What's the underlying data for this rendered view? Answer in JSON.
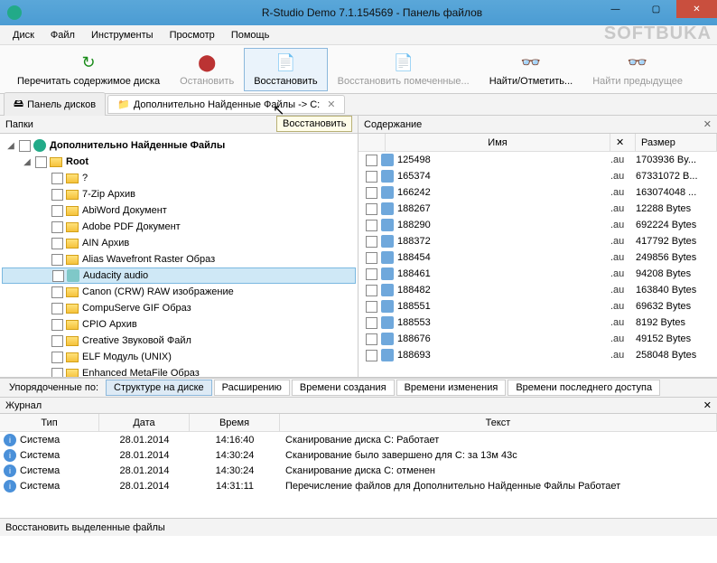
{
  "window": {
    "title": "R-Studio Demo 7.1.154569 - Панель файлов",
    "watermark": "SOFTBUKA"
  },
  "menu": [
    "Диск",
    "Файл",
    "Инструменты",
    "Просмотр",
    "Помощь"
  ],
  "toolbar": [
    {
      "id": "refresh",
      "label": "Перечитать содержимое диска",
      "icon": "↻",
      "color": "#1a8c1a"
    },
    {
      "id": "stop",
      "label": "Остановить",
      "icon": "⬤",
      "color": "#b33",
      "disabled": true
    },
    {
      "id": "restore",
      "label": "Восстановить",
      "icon": "📄",
      "color": "#d88",
      "active": true
    },
    {
      "id": "restore-marked",
      "label": "Восстановить помеченные...",
      "icon": "📄",
      "color": "#bbb",
      "disabled": true
    },
    {
      "id": "find",
      "label": "Найти/Отметить...",
      "icon": "👓",
      "color": "#4a90d9"
    },
    {
      "id": "find-prev",
      "label": "Найти предыдущее",
      "icon": "👓",
      "color": "#bbb",
      "disabled": true
    }
  ],
  "tooltip": "Восстановить",
  "tabs": [
    {
      "id": "disks",
      "icon": "🖴",
      "label": "Панель дисков"
    },
    {
      "id": "extra",
      "icon": "📁",
      "label": "Дополнительно Найденные Файлы  ->  C:",
      "active": true
    }
  ],
  "leftPane": {
    "title": "Папки",
    "root": {
      "expander": "◢",
      "label": "Дополнительно Найденные Файлы",
      "bold": true,
      "indent": 0,
      "iconType": "green"
    },
    "rootsub": {
      "expander": "◢",
      "label": "Root",
      "bold": true,
      "indent": 1,
      "iconType": "folder"
    },
    "items": [
      {
        "label": "?"
      },
      {
        "label": "7-Zip Архив"
      },
      {
        "label": "AbiWord Документ"
      },
      {
        "label": "Adobe PDF Документ"
      },
      {
        "label": "AIN Архив"
      },
      {
        "label": "Alias Wavefront Raster Образ"
      },
      {
        "label": "Audacity audio",
        "selected": true,
        "iconType": "aud"
      },
      {
        "label": "Canon (CRW) RAW изображение"
      },
      {
        "label": "CompuServe GIF Образ"
      },
      {
        "label": "CPIO Архив"
      },
      {
        "label": "Creative Звуковой Файл"
      },
      {
        "label": "ELF Модуль (UNIX)"
      },
      {
        "label": "Enhanced MetaFile Образ"
      }
    ]
  },
  "rightPane": {
    "title": "Содержание",
    "columns": {
      "name": "Имя",
      "x": "✕",
      "size": "Размер"
    },
    "files": [
      {
        "name": "125498",
        "ext": ".au",
        "size": "1703936 By..."
      },
      {
        "name": "165374",
        "ext": ".au",
        "size": "67331072 B..."
      },
      {
        "name": "166242",
        "ext": ".au",
        "size": "163074048 ..."
      },
      {
        "name": "188267",
        "ext": ".au",
        "size": "12288 Bytes"
      },
      {
        "name": "188290",
        "ext": ".au",
        "size": "692224 Bytes"
      },
      {
        "name": "188372",
        "ext": ".au",
        "size": "417792 Bytes"
      },
      {
        "name": "188454",
        "ext": ".au",
        "size": "249856 Bytes"
      },
      {
        "name": "188461",
        "ext": ".au",
        "size": "94208 Bytes"
      },
      {
        "name": "188482",
        "ext": ".au",
        "size": "163840 Bytes"
      },
      {
        "name": "188551",
        "ext": ".au",
        "size": "69632 Bytes"
      },
      {
        "name": "188553",
        "ext": ".au",
        "size": "8192 Bytes"
      },
      {
        "name": "188676",
        "ext": ".au",
        "size": "49152 Bytes"
      },
      {
        "name": "188693",
        "ext": ".au",
        "size": "258048 Bytes"
      }
    ]
  },
  "sortbar": {
    "label": "Упорядоченные по:",
    "buttons": [
      {
        "label": "Структуре на диске",
        "active": true
      },
      {
        "label": "Расширению"
      },
      {
        "label": "Времени создания"
      },
      {
        "label": "Времени изменения"
      },
      {
        "label": "Времени последнего доступа"
      }
    ]
  },
  "journal": {
    "title": "Журнал",
    "columns": {
      "type": "Тип",
      "date": "Дата",
      "time": "Время",
      "text": "Текст"
    },
    "rows": [
      {
        "type": "Система",
        "date": "28.01.2014",
        "time": "14:16:40",
        "text": "Сканирование диска C: Работает"
      },
      {
        "type": "Система",
        "date": "28.01.2014",
        "time": "14:30:24",
        "text": "Сканирование было завершено для C: за 13м 43с"
      },
      {
        "type": "Система",
        "date": "28.01.2014",
        "time": "14:30:24",
        "text": "Сканирование диска C: отменен"
      },
      {
        "type": "Система",
        "date": "28.01.2014",
        "time": "14:31:11",
        "text": "Перечисление файлов для Дополнительно Найденные Файлы Работает"
      }
    ]
  },
  "status": "Восстановить выделенные файлы"
}
